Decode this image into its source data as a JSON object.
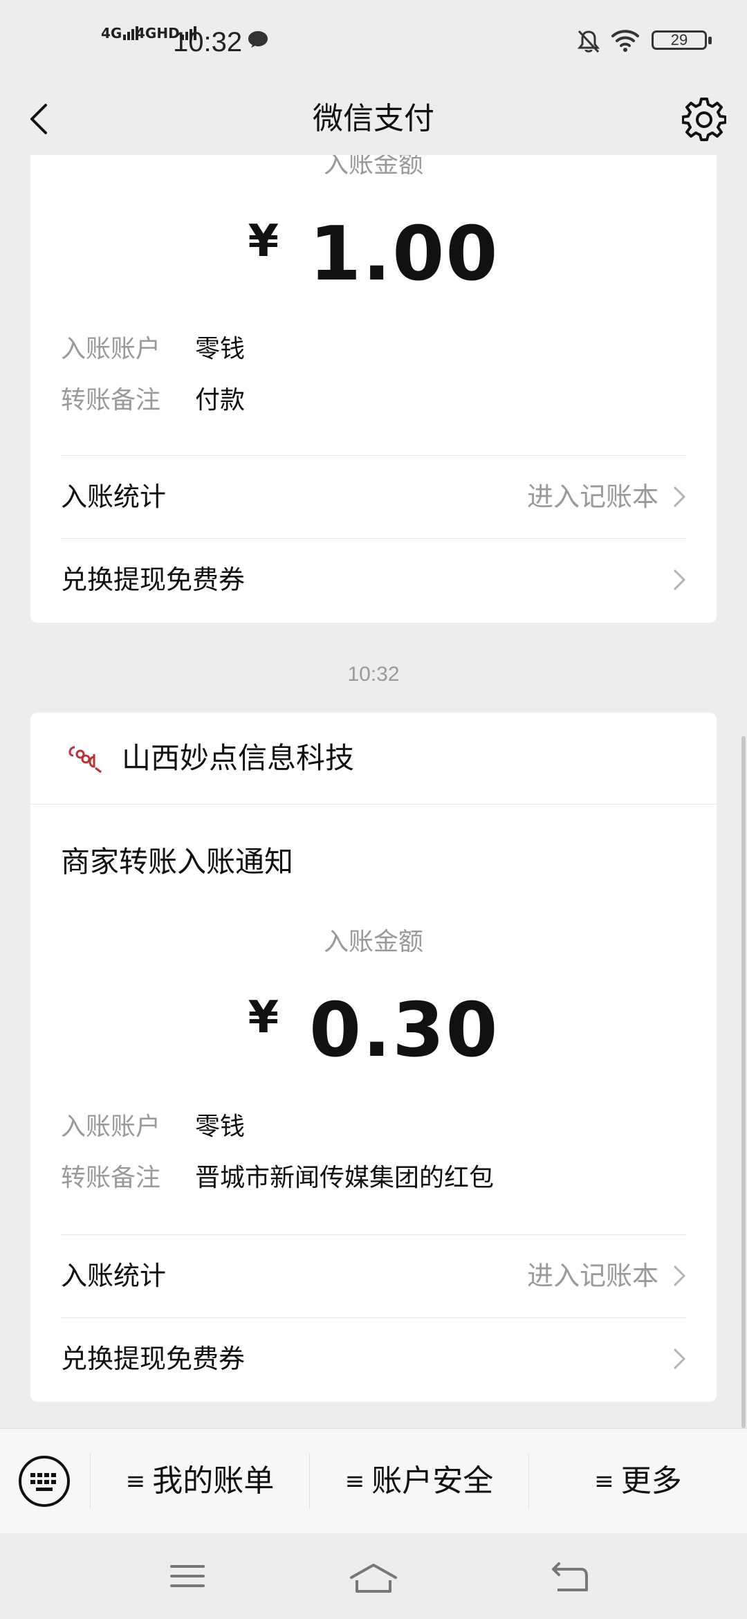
{
  "status_bar": {
    "network_1": "4G",
    "network_2": "4GHD",
    "time": "10:32",
    "battery": "29",
    "icons": [
      "signal-icon",
      "message-icon",
      "mute-icon",
      "wifi-icon",
      "battery-icon"
    ]
  },
  "nav": {
    "title": "微信支付",
    "icons": [
      "back-icon",
      "settings-icon"
    ]
  },
  "cards": [
    {
      "amount_label": "入账金额",
      "currency": "¥",
      "amount": "1.00",
      "rows": [
        {
          "key": "入账账户",
          "value": "零钱"
        },
        {
          "key": "转账备注",
          "value": "付款"
        }
      ],
      "links": [
        {
          "label": "入账统计",
          "hint": "进入记账本"
        },
        {
          "label": "兑换提现免费券",
          "hint": ""
        }
      ]
    },
    {
      "merchant": "山西妙点信息科技",
      "title": "商家转账入账通知",
      "amount_label": "入账金额",
      "currency": "¥",
      "amount": "0.30",
      "rows": [
        {
          "key": "入账账户",
          "value": "零钱"
        },
        {
          "key": "转账备注",
          "value": "晋城市新闻传媒集团的红包"
        }
      ],
      "links": [
        {
          "label": "入账统计",
          "hint": "进入记账本"
        },
        {
          "label": "兑换提现免费券",
          "hint": ""
        }
      ]
    }
  ],
  "timestamp": "10:32",
  "bottom_menu": {
    "items": [
      {
        "label": "我的账单"
      },
      {
        "label": "账户安全"
      },
      {
        "label": "更多"
      }
    ]
  },
  "colors": {
    "background": "#ededed",
    "card": "#ffffff",
    "secondary_text": "#9a9a9a",
    "primary_text": "#111111",
    "logo_red": "#b8323a"
  }
}
